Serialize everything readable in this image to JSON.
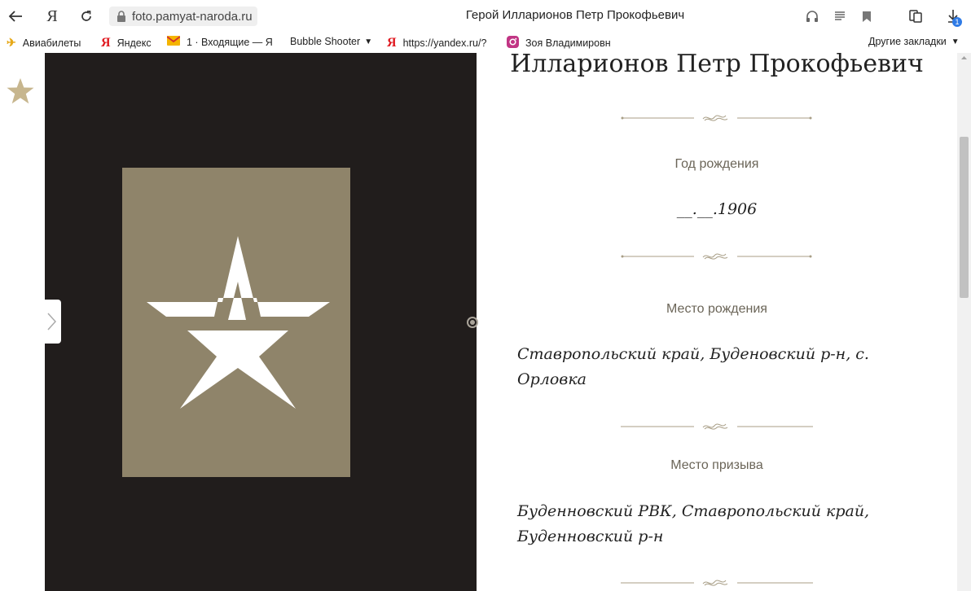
{
  "browser": {
    "url": "foto.pamyat-naroda.ru",
    "page_title": "Герой Илларионов Петр Прокофьевич",
    "download_count": "1"
  },
  "bookmarks": {
    "items": [
      {
        "label": "Авиабилеты",
        "icon": "plane-icon"
      },
      {
        "label": "Яндекс",
        "icon": "yandex-icon"
      },
      {
        "label": "1 · Входящие — Я",
        "icon": "mail-icon"
      },
      {
        "label": "Bubble Shooter",
        "icon": "folder"
      },
      {
        "label": "https://yandex.ru/?",
        "icon": "yandex-icon"
      },
      {
        "label": "Зоя Владимировн",
        "icon": "instagram-icon"
      }
    ],
    "other": "Другие закладки"
  },
  "hero": {
    "name": "Илларионов Петр Прокофьевич",
    "birth_year_label": "Год рождения",
    "birth_year": "__.__.1906",
    "birth_place_label": "Место рождения",
    "birth_place": "Ставропольский край, Буденовский р-н, с. Орловка",
    "draft_place_label": "Место призыва",
    "draft_place": "Буденновский РВК, Ставропольский край, Буденновский р-н"
  },
  "colors": {
    "accent_gold": "#c7b68e",
    "photo_bg": "#8f846a",
    "panel_dark": "#211d1c"
  }
}
